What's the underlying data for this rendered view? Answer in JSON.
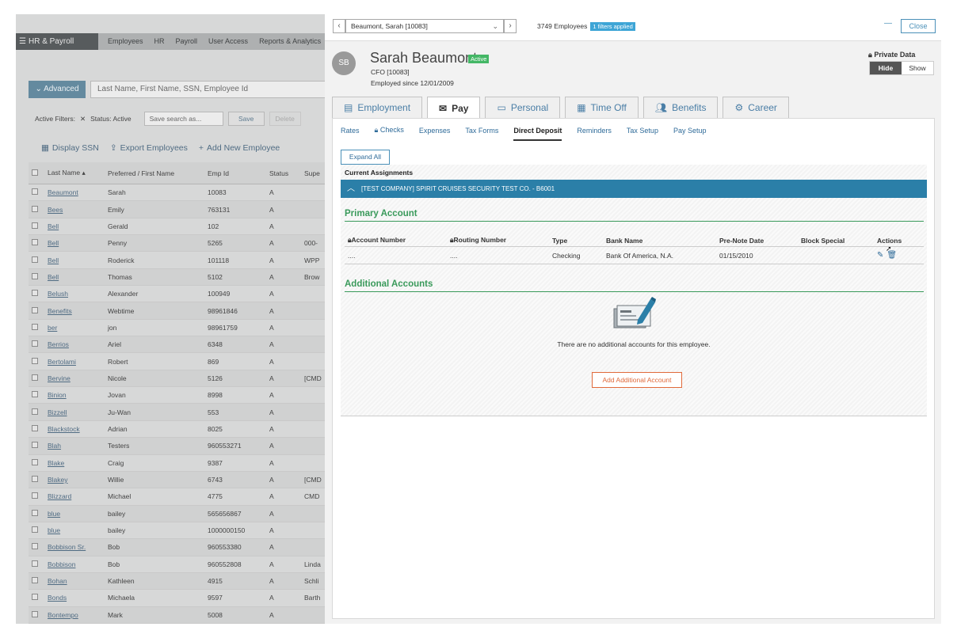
{
  "background": {
    "brand": "HR & Payroll",
    "nav": [
      "Employees",
      "HR",
      "Payroll",
      "User Access",
      "Reports & Analytics"
    ],
    "advanced_label": "Advanced",
    "search_placeholder": "Last Name, First Name, SSN, Employee Id",
    "active_filters_label": "Active Filters:",
    "status_filter": "Status: Active",
    "save_search_placeholder": "Save search as...",
    "save_label": "Save",
    "delete_label": "Delete",
    "actions": [
      "Display SSN",
      "Export Employees",
      "Add New Employee"
    ],
    "columns": [
      "Last Name",
      "Preferred / First Name",
      "Emp Id",
      "Status",
      "Supe"
    ],
    "rows": [
      [
        "Beaumont",
        "Sarah",
        "10083",
        "A",
        ""
      ],
      [
        "Bees",
        "Emily",
        "763131",
        "A",
        ""
      ],
      [
        "Bell",
        "Gerald",
        "102",
        "A",
        ""
      ],
      [
        "Bell",
        "Penny",
        "5265",
        "A",
        "000-"
      ],
      [
        "Bell",
        "Roderick",
        "101118",
        "A",
        "WPP"
      ],
      [
        "Bell",
        "Thomas",
        "5102",
        "A",
        "Brow"
      ],
      [
        "Belush",
        "Alexander",
        "100949",
        "A",
        ""
      ],
      [
        "Benefits",
        "Webtime",
        "98961846",
        "A",
        ""
      ],
      [
        "ber",
        "jon",
        "98961759",
        "A",
        ""
      ],
      [
        "Berrios",
        "Ariel",
        "6348",
        "A",
        ""
      ],
      [
        "Bertolami",
        "Robert",
        "869",
        "A",
        ""
      ],
      [
        "Bervine",
        "Nicole",
        "5126",
        "A",
        "[CMD"
      ],
      [
        "Binion",
        "Jovan",
        "8998",
        "A",
        ""
      ],
      [
        "Bizzell",
        "Ju-Wan",
        "553",
        "A",
        ""
      ],
      [
        "Blackstock",
        "Adrian",
        "8025",
        "A",
        ""
      ],
      [
        "Blah",
        "Testers",
        "960553271",
        "A",
        ""
      ],
      [
        "Blake",
        "Craig",
        "9387",
        "A",
        ""
      ],
      [
        "Blakey",
        "Willie",
        "6743",
        "A",
        "[CMD"
      ],
      [
        "Blizzard",
        "Michael",
        "4775",
        "A",
        "CMD"
      ],
      [
        "blue",
        "bailey",
        "565656867",
        "A",
        ""
      ],
      [
        "blue",
        "bailey",
        "1000000150",
        "A",
        ""
      ],
      [
        "Bobbison Sr.",
        "Bob",
        "960553380",
        "A",
        ""
      ],
      [
        "Bobbison",
        "Bob",
        "960552808",
        "A",
        "Linda"
      ],
      [
        "Bohan",
        "Kathleen",
        "4915",
        "A",
        "Schli"
      ],
      [
        "Bonds",
        "Michaela",
        "9597",
        "A",
        "Barth"
      ],
      [
        "Bontempo",
        "Mark",
        "5008",
        "A",
        ""
      ]
    ]
  },
  "panel": {
    "selected_employee": "Beaumont, Sarah [10083]",
    "employee_count": "3749 Employees",
    "filters_badge": "1 filters applied",
    "minimize": "—",
    "close_label": "Close",
    "initials": "SB",
    "name": "Sarah Beaumont",
    "status_badge": "Active",
    "title": "CFO [10083]",
    "employed_since": "Employed since 12/01/2009",
    "private_label": "Private Data",
    "hide_label": "Hide",
    "show_label": "Show",
    "tabs": [
      "Employment",
      "Pay",
      "Personal",
      "Time Off",
      "Benefits",
      "Career"
    ],
    "subtabs": [
      "Rates",
      "Checks",
      "Expenses",
      "Tax Forms",
      "Direct Deposit",
      "Reminders",
      "Tax Setup",
      "Pay Setup"
    ],
    "expand_all": "Expand All",
    "current_assignments": "Current Assignments",
    "company": "[TEST COMPANY] SPIRIT CRUISES SECURITY TEST CO. - B6001",
    "primary_title": "Primary Account",
    "account_columns": [
      "Account Number",
      "Routing Number",
      "Type",
      "Bank Name",
      "Pre-Note Date",
      "Block Special",
      "Actions"
    ],
    "primary_row": [
      "....",
      "....",
      "Checking",
      "Bank Of America, N.A.",
      "01/15/2010",
      ""
    ],
    "additional_title": "Additional Accounts",
    "no_accounts": "There are no additional accounts for this employee.",
    "add_button": "Add Additional Account"
  },
  "colors": {
    "accent": "#2b7fa8",
    "green": "#3a9a5b",
    "orange": "#e06a3b"
  }
}
